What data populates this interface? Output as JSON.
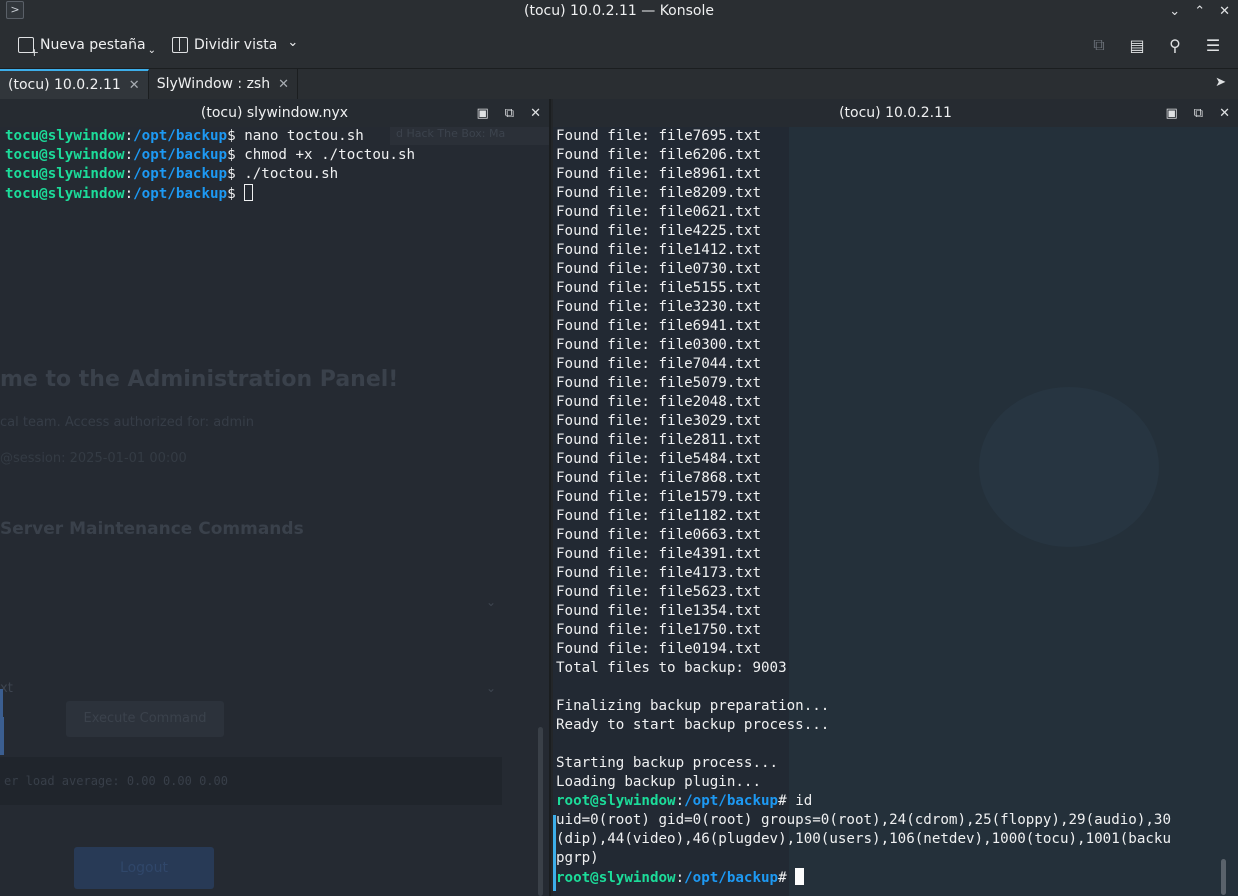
{
  "window": {
    "title": "(tocu) 10.0.2.11 — Konsole"
  },
  "toolbar": {
    "new_tab_label": "Nueva pestaña",
    "split_view_label": "Dividir vista"
  },
  "tabs": [
    {
      "label": "(tocu) 10.0.2.11",
      "active": true
    },
    {
      "label": "SlyWindow : zsh",
      "active": false
    }
  ],
  "left_pane": {
    "title": "(tocu) slywindow.nyx",
    "prompt_user": "tocu@slywindow",
    "prompt_path": "/opt/backup",
    "lines": [
      {
        "cmd": "nano toctou.sh"
      },
      {
        "cmd": "chmod +x ./toctou.sh"
      },
      {
        "cmd": "./toctou.sh"
      },
      {
        "cmd": ""
      }
    ],
    "background": {
      "title": "me to the Administration Panel!",
      "line1": "cal team. Access authorized for: admin",
      "line2": "@session: 2025-01-01 00:00",
      "section": "Server Maintenance Commands",
      "select_value": "xt",
      "button1": "Execute Command",
      "box": "er   load average: 0.00  0.00  0.00",
      "button2": "Logout",
      "strip": "d Hack The Box: Ma"
    }
  },
  "right_pane": {
    "title": "(tocu) 10.0.2.11",
    "found_prefix": "Found file: ",
    "files": [
      "file7695.txt",
      "file6206.txt",
      "file8961.txt",
      "file8209.txt",
      "file0621.txt",
      "file4225.txt",
      "file1412.txt",
      "file0730.txt",
      "file5155.txt",
      "file3230.txt",
      "file6941.txt",
      "file0300.txt",
      "file7044.txt",
      "file5079.txt",
      "file2048.txt",
      "file3029.txt",
      "file2811.txt",
      "file5484.txt",
      "file7868.txt",
      "file1579.txt",
      "file1182.txt",
      "file0663.txt",
      "file4391.txt",
      "file4173.txt",
      "file5623.txt",
      "file1354.txt",
      "file1750.txt",
      "file0194.txt"
    ],
    "total_line": "Total files to backup: 9003",
    "finalizing": "Finalizing backup preparation...",
    "ready": "Ready to start backup process...",
    "starting": "Starting backup process...",
    "loading": "Loading backup plugin...",
    "root_user": "root@slywindow",
    "root_path": "/opt/backup",
    "root_cmd": "id",
    "id_out1": "uid=0(root) gid=0(root) groups=0(root),24(cdrom),25(floppy),29(audio),30",
    "id_out2": "(dip),44(video),46(plugdev),100(users),106(netdev),1000(tocu),1001(backu",
    "id_out3": "pgrp)"
  }
}
